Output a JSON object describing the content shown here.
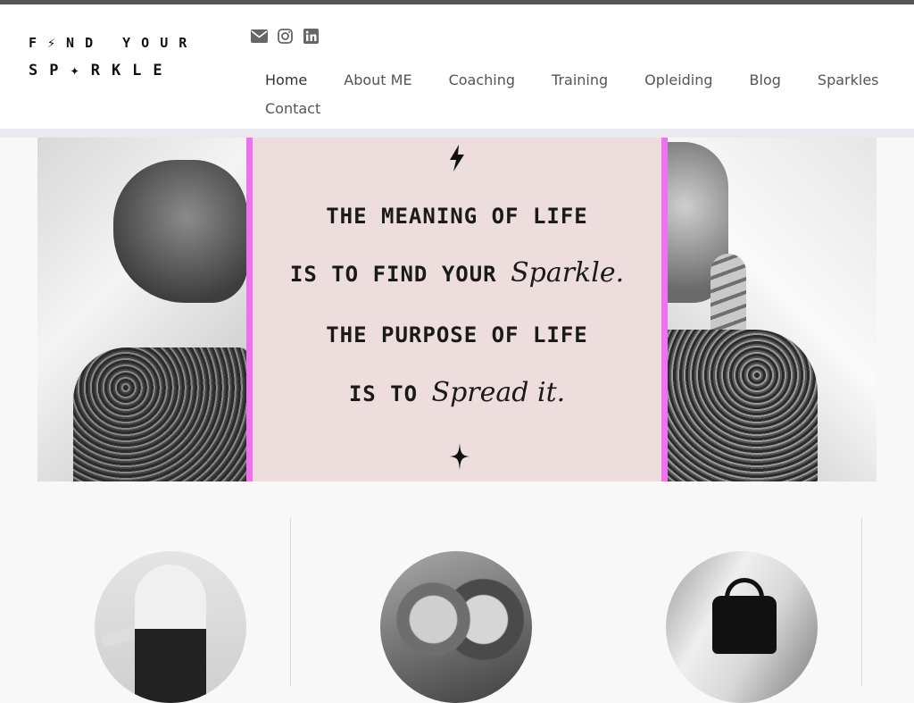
{
  "brand": {
    "line1": "F⚡ND YOUR",
    "line2": "SP✦RKLE"
  },
  "social": [
    {
      "icon": "envelope-icon"
    },
    {
      "icon": "instagram-icon"
    },
    {
      "icon": "linkedin-icon"
    }
  ],
  "nav": {
    "items": [
      "Home",
      "About ME",
      "Coaching",
      "Training",
      "Opleiding",
      "Blog",
      "Sparkles",
      "Contact"
    ],
    "active": "Home"
  },
  "hero": {
    "line1": "THE MEANING OF LIFE",
    "line2_prefix": "IS TO FIND YOUR",
    "line2_script": "Sparkle.",
    "line3": "THE PURPOSE OF LIFE",
    "line4_prefix": "IS TO",
    "line4_script": "Spread it."
  },
  "colors": {
    "accent": "#f070f0",
    "panel": "#eddddd",
    "nav_text": "#555555"
  }
}
